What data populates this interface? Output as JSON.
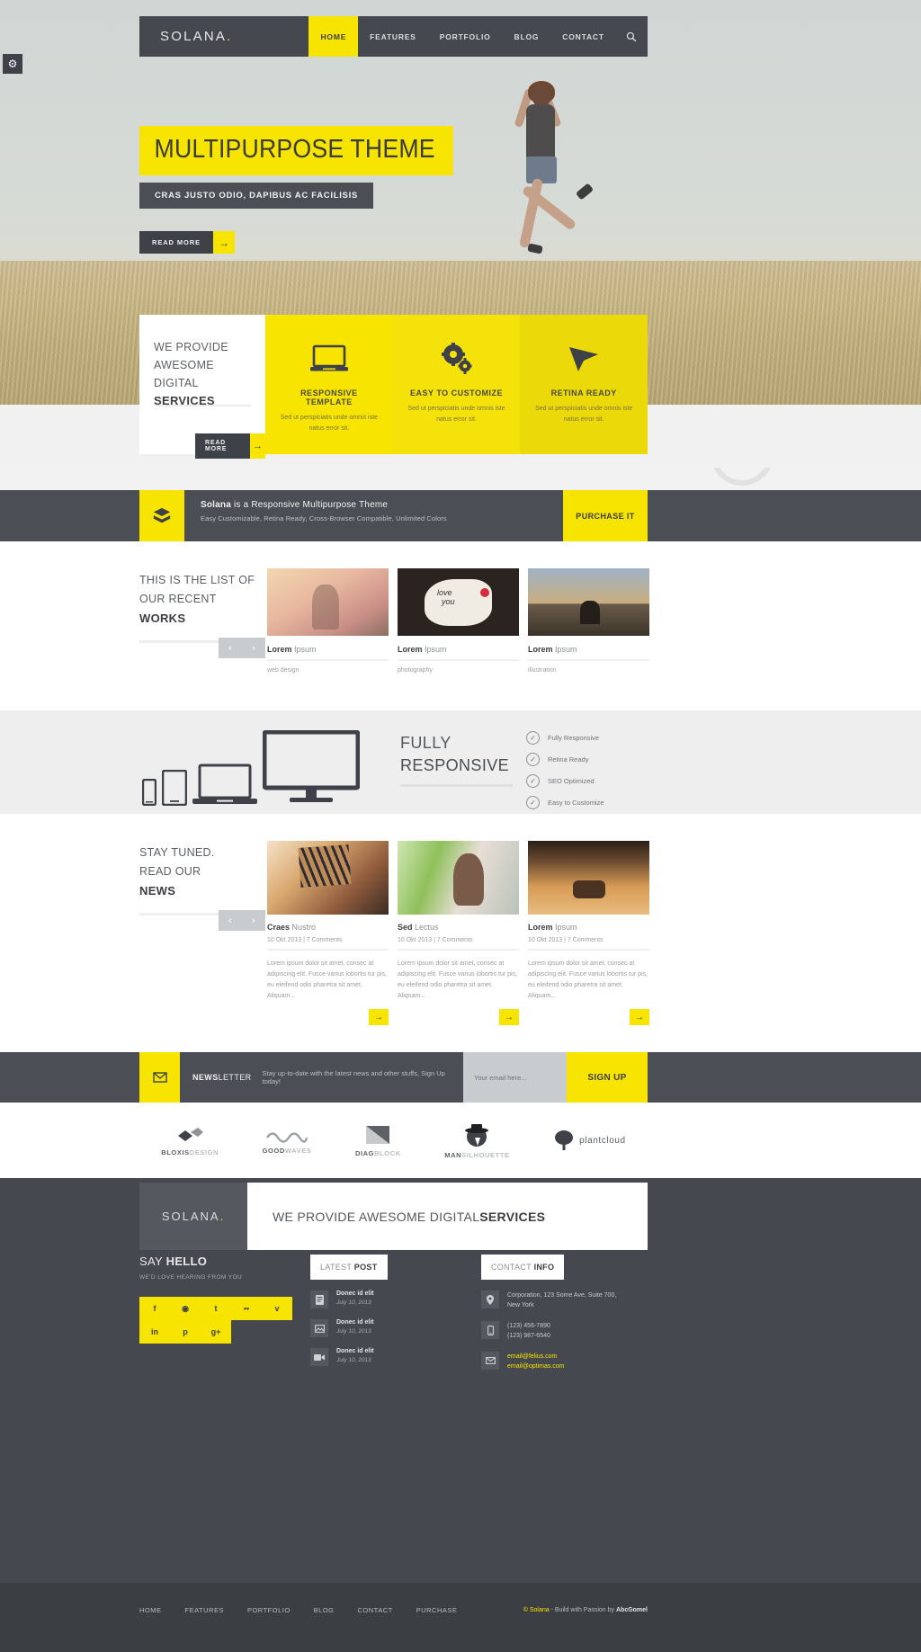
{
  "header": {
    "logo": "SOLANA",
    "logo_dot": ".",
    "nav": [
      {
        "label": "HOME",
        "active": true
      },
      {
        "label": "FEATURES",
        "active": false
      },
      {
        "label": "PORTFOLIO",
        "active": false
      },
      {
        "label": "BLOG",
        "active": false
      },
      {
        "label": "CONTACT",
        "active": false
      }
    ],
    "search_icon": "search-icon",
    "settings_icon": "gear-icon"
  },
  "hero": {
    "title": "MULTIPURPOSE THEME",
    "subtitle": "CRAS JUSTO ODIO, DAPIBUS AC FACILISIS",
    "button": "READ MORE",
    "button_arrow": "→"
  },
  "services": {
    "intro_l1": "WE PROVIDE",
    "intro_l2": "AWESOME DIGITAL",
    "intro_l3": "SERVICES",
    "read_more": "READ MORE",
    "read_more_arrow": "→",
    "cards": [
      {
        "icon": "laptop-icon",
        "title": "RESPONSIVE TEMPLATE",
        "desc": "Sed ut perspiciatis unde omnis iste natus error sit."
      },
      {
        "icon": "gears-icon",
        "title": "EASY TO CUSTOMIZE",
        "desc": "Sed ut perspiciatis unde omnis iste natus error sit."
      },
      {
        "icon": "cursor-icon",
        "title": "RETINA READY",
        "desc": "Sed ut perspiciatis unde omnis iste natus error sit."
      }
    ]
  },
  "purchase": {
    "icon": "box-icon",
    "title_bold": "Solana",
    "title_rest": " is a Responsive Multipurpose Theme",
    "subtitle": "Easy Customizable, Retina Ready, Cross-Browser Compatible, Unlimited Colors",
    "button": "PURCHASE IT"
  },
  "works": {
    "head_l1": "THIS IS THE LIST OF",
    "head_l2": "OUR RECENT",
    "head_l3": "WORKS",
    "prev": "‹",
    "next": "›",
    "items": [
      {
        "title_bold": "Lorem",
        "title_rest": " Ipsum",
        "category": "web design"
      },
      {
        "title_bold": "Lorem",
        "title_rest": " Ipsum",
        "category": "photography"
      },
      {
        "title_bold": "Lorem",
        "title_rest": " Ipsum",
        "category": "illustration"
      }
    ]
  },
  "responsive": {
    "title_l1": "FULLY",
    "title_l2": "RESPONSIVE",
    "features": [
      {
        "label": "Fully Responsive",
        "check": "✓"
      },
      {
        "label": "Retina Ready",
        "check": "✓"
      },
      {
        "label": "SEO Optimized",
        "check": "✓"
      },
      {
        "label": "Easy to Customize",
        "check": "✓"
      }
    ],
    "devices": [
      "phone-icon",
      "tablet-icon",
      "laptop-icon",
      "monitor-icon"
    ]
  },
  "news": {
    "head_l1": "STAY TUNED.",
    "head_l2": "READ OUR",
    "head_l3": "NEWS",
    "prev": "‹",
    "next": "›",
    "arrow": "→",
    "items": [
      {
        "title_bold": "Craes",
        "title_rest": " Nustro",
        "meta": "10 Okt 2013 | 7 Comments",
        "body": "Lorem ipsum dolor sit amet, consec at adipiscing elit. Fusce varius lobortis tur pis, eu eleifend odio pharetra sit amet. Aliquam..."
      },
      {
        "title_bold": "Sed",
        "title_rest": " Lectus",
        "meta": "10 Okt 2013 | 7 Comments",
        "body": "Lorem ipsum dolor sit amet, consec at adipiscing elit. Fusce varius lobortis tur pis, eu eleifend odio pharetra sit amet. Aliquam..."
      },
      {
        "title_bold": "Lorem",
        "title_rest": " Ipsum",
        "meta": "10 Okt 2013 | 7 Comments",
        "body": "Lorem ipsum dolor sit amet, consec at adipiscing elit. Fusce varius lobortis tur pis, eu eleifend odio pharetra sit amet. Aliquam..."
      }
    ]
  },
  "newsletter": {
    "icon": "envelope-icon",
    "label_bold": "NEWS",
    "label_rest": " LETTER",
    "desc": "Stay up-to-date with the latest news and other stuffs, Sign Up today!",
    "input_placeholder": "Your email here...",
    "button": "SIGN UP"
  },
  "clients": [
    {
      "name_bold": "BLOXIS",
      "name_light": "DESIGN",
      "icon": "blocks-icon"
    },
    {
      "name_bold": "GOOD",
      "name_light": "WAVES",
      "icon": "waves-icon"
    },
    {
      "name_bold": "DIAG",
      "name_light": "BLOCK",
      "icon": "diagonal-icon"
    },
    {
      "name_bold": "MAN",
      "name_light": "SILHOUETTE",
      "icon": "man-hat-icon"
    },
    {
      "name_bold": "",
      "name_light": "plantcloud",
      "icon": "tree-icon"
    }
  ],
  "footer": {
    "logo": "SOLANA",
    "logo_dot": ".",
    "claim_light": "WE PROVIDE AWESOME DIGITAL ",
    "claim_bold": "SERVICES",
    "say_hello_light": "SAY ",
    "say_hello_bold": "HELLO",
    "say_hello_sub": "WE'D LOVE HEARING FROM YOU",
    "social": [
      {
        "glyph": "f",
        "name": "facebook-icon"
      },
      {
        "glyph": "◉",
        "name": "dribbble-icon"
      },
      {
        "glyph": "t",
        "name": "twitter-icon"
      },
      {
        "glyph": "••",
        "name": "flickr-icon"
      },
      {
        "glyph": "v",
        "name": "vimeo-icon"
      },
      {
        "glyph": "in",
        "name": "linkedin-icon"
      },
      {
        "glyph": "p",
        "name": "pinterest-icon"
      },
      {
        "glyph": "g+",
        "name": "googleplus-icon"
      }
    ],
    "latest_post_light": "LATEST ",
    "latest_post_bold": "POST",
    "posts": [
      {
        "title": "Donec id elit",
        "date": "July 10, 2013",
        "icon": "document-icon"
      },
      {
        "title": "Donec id elit",
        "date": "July 10, 2013",
        "icon": "image-icon"
      },
      {
        "title": "Donec id elit",
        "date": "July 10, 2013",
        "icon": "video-icon"
      }
    ],
    "contact_light": "CONTACT ",
    "contact_bold": "INFO",
    "contact": [
      {
        "icon": "pin-icon",
        "line1": "Corporation, 123 Some Ave, Suite 700,",
        "line2": "New York"
      },
      {
        "icon": "phone-icon",
        "line1": "(123) 456-7890",
        "line2": "(123) 987-6540"
      },
      {
        "icon": "mail-icon",
        "line1": "email@felius.com",
        "line2": "email@optimas.com"
      }
    ],
    "bottom_nav": [
      "HOME",
      "FEATURES",
      "PORTFOLIO",
      "BLOG",
      "CONTACT",
      "PURCHASE"
    ],
    "copyright_pre": "© Solana",
    "copyright_mid": " - Build with Passion by ",
    "copyright_author": "AbcGomel"
  }
}
